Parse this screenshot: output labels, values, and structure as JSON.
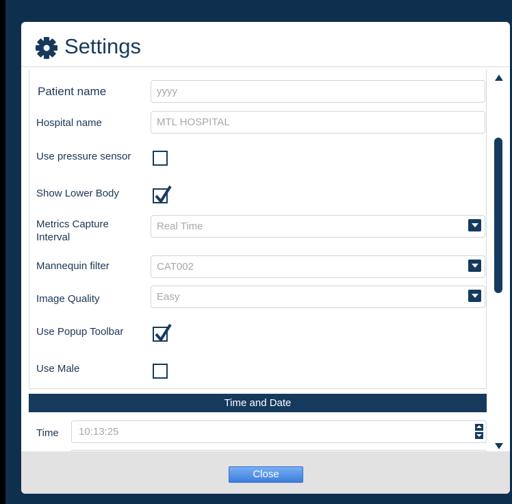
{
  "dialog": {
    "title": "Settings",
    "title_icon": "gear-icon",
    "fields": {
      "patient_name": {
        "label": "Patient name",
        "value": "yyyy"
      },
      "hospital_name": {
        "label": "Hospital name",
        "value": "MTL HOSPITAL"
      },
      "use_pressure_sensor": {
        "label": "Use pressure sensor",
        "checked": false
      },
      "show_lower_body": {
        "label": "Show Lower Body",
        "checked": true
      },
      "metrics_capture_interval": {
        "label_line1": "Metrics Capture",
        "label_line2": "Interval",
        "value": "Real Time"
      },
      "mannequin_filter": {
        "label": "Mannequin filter",
        "value": "CAT002"
      },
      "image_quality": {
        "label": "Image Quality",
        "value": "Easy"
      },
      "use_popup_toolbar": {
        "label": "Use Popup Toolbar",
        "checked": true
      },
      "use_male": {
        "label": "Use Male",
        "checked": false
      }
    },
    "time_and_date": {
      "header": "Time and Date",
      "time_label": "Time",
      "time_value": "10:13:25"
    },
    "close_label": "Close"
  },
  "colors": {
    "accent": "#163a5e",
    "background": "#0f2f4f",
    "button": "#3b7fdd"
  }
}
